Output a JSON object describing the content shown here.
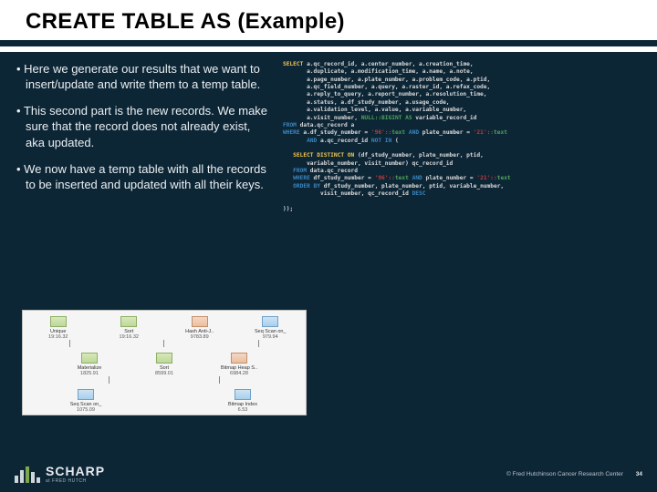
{
  "slide": {
    "title": "CREATE TABLE AS (Example)",
    "bullets": [
      "Here we generate our results that we want to insert/update and write them to a temp table.",
      "This second part is the new records. We make sure that the record does not already exist, aka updated.",
      "We now have a temp table with all the records to be inserted and updated with all their keys."
    ]
  },
  "sql": {
    "l01a": "SELECT",
    "l01b": " a.qc_record_id, a.center_number, a.creation_time,",
    "l02": "       a.duplicate, a.modification_time, a.name, a.note,",
    "l03": "       a.page_number, a.plate_number, a.problem_code, a.ptid,",
    "l04": "       a.qc_field_number, a.query, a.raster_id, a.refax_code,",
    "l05": "       a.reply_to_query, a.report_number, a.resolution_time,",
    "l06": "       a.status, a.df_study_number, a.usage_code,",
    "l07": "       a.validation_level, a.value, a.variable_number,",
    "l08a": "       a.visit_number, ",
    "l08b": "NULL::BIGINT AS",
    "l08c": " variable_record_id",
    "l09a": "FROM",
    "l09b": " data.qc_record a",
    "l10a": "WHERE",
    "l10b": " a.df_study_number = ",
    "l10c": "'96'::",
    "l10d": "text ",
    "l10e": "AND",
    "l10f": " plate_number = ",
    "l10g": "'21'::",
    "l10h": "text",
    "l11a": "       AND",
    "l11b": " a.qc_record_id ",
    "l11c": "NOT IN",
    "l11d": " (",
    "l12": "",
    "l13a": "   SELECT DISTINCT ON",
    "l13b": " (df_study_number, plate_number, ptid,",
    "l14": "       variable_number, visit_number) qc_record_id",
    "l15a": "   FROM",
    "l15b": " data.qc_record",
    "l16a": "   WHERE",
    "l16b": " df_study_number = ",
    "l16c": "'96'::",
    "l16d": "text ",
    "l16e": "AND",
    "l16f": " plate_number = ",
    "l16g": "'21'::",
    "l16h": "text",
    "l17a": "   ORDER BY",
    "l17b": " df_study_number, plate_number, ptid, variable_number,",
    "l18a": "           visit_number, qc_record_id ",
    "l18b": "DESC",
    "l19": "",
    "l20": "));"
  },
  "plan": {
    "row1": [
      {
        "label": "Unique",
        "sub": "19:16.32",
        "icon": "plan-icon"
      },
      {
        "label": "Sort",
        "sub": "19:16.32",
        "icon": "plan-icon"
      },
      {
        "label": "Hash Anti-J..",
        "sub": "9783.89",
        "icon": "hash"
      },
      {
        "label": "Seq Scan on_",
        "sub": "979.94",
        "icon": "scan"
      }
    ],
    "row2": [
      {
        "label": "Materialize",
        "sub": "1825.91",
        "icon": "plan-icon"
      },
      {
        "label": "Sort",
        "sub": "8599.01",
        "icon": "plan-icon"
      },
      {
        "label": "Bitmap Heap S..",
        "sub": "6984.28",
        "icon": "hash"
      }
    ],
    "row3": [
      {
        "label": "Seq Scan on_",
        "sub": "1075.09",
        "icon": "scan"
      },
      {
        "label": "Bitmap Index",
        "sub": "6.53",
        "icon": "scan"
      }
    ]
  },
  "footer": {
    "logo_text": "SCHARP",
    "logo_sub": "at FRED HUTCH",
    "copyright": "© Fred Hutchinson Cancer Research Center",
    "page": "34"
  }
}
